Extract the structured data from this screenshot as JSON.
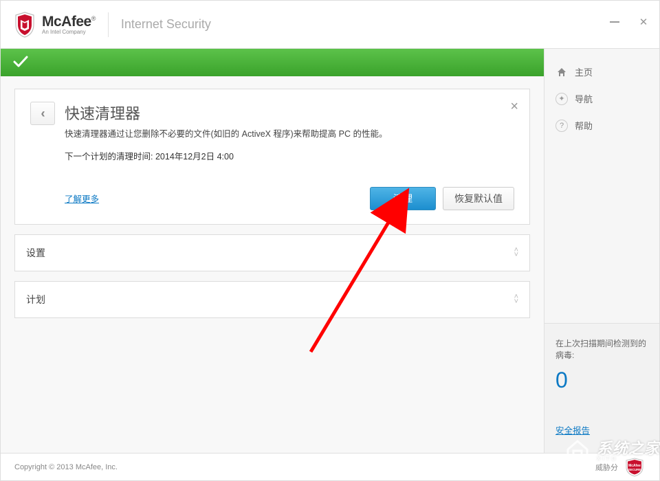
{
  "header": {
    "brand_main": "McAfee",
    "brand_reg": "®",
    "brand_sub": "An Intel Company",
    "product_name": "Internet Security"
  },
  "card": {
    "title": "快速清理器",
    "description": "快速清理器通过让您删除不必要的文件(如旧的 ActiveX 程序)来帮助提高 PC 的性能。",
    "schedule_label": "下一个计划的清理时间:",
    "schedule_value": "2014年12月2日 4:00",
    "learn_more": "了解更多",
    "primary_button": "清理",
    "secondary_button": "恢复默认值"
  },
  "accordions": {
    "settings": "设置",
    "plan": "计划"
  },
  "sidebar": {
    "nav": {
      "home": "主页",
      "navigation": "导航",
      "help": "帮助"
    },
    "scan_panel": {
      "label": "在上次扫描期间检测到的病毒:",
      "count": "0",
      "report_link": "安全报告"
    }
  },
  "footer": {
    "copyright": "Copyright © 2013 McAfee, Inc.",
    "threat_text": "威胁分"
  },
  "watermark": {
    "main": "系统之家",
    "sub": "XITO"
  }
}
